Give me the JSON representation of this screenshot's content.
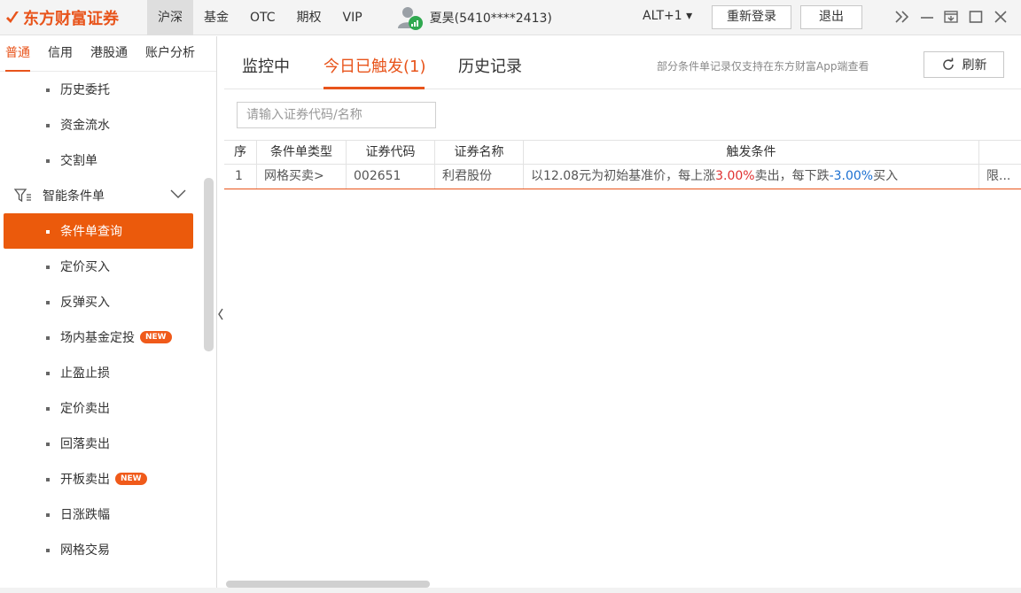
{
  "app": {
    "logo_text": "东方财富证券",
    "brand_color": "#e8541b"
  },
  "topbar": {
    "market_tabs": [
      {
        "label": "沪深",
        "active": true
      },
      {
        "label": "基金",
        "active": false
      },
      {
        "label": "OTC",
        "active": false
      },
      {
        "label": "期权",
        "active": false
      },
      {
        "label": "VIP",
        "active": false
      }
    ],
    "user_label": "夏昊(5410****2413)",
    "alt_label": "ALT+1 ▾",
    "relogin_label": "重新登录",
    "logout_label": "退出"
  },
  "sidebar": {
    "tabs": [
      {
        "label": "普通",
        "active": true
      },
      {
        "label": "信用",
        "active": false
      },
      {
        "label": "港股通",
        "active": false
      },
      {
        "label": "账户分析",
        "active": false
      }
    ],
    "items_top": [
      {
        "label": "历史委托"
      },
      {
        "label": "资金流水"
      },
      {
        "label": "交割单"
      }
    ],
    "group_label": "智能条件单",
    "items": [
      {
        "label": "条件单查询",
        "active": true,
        "badge": ""
      },
      {
        "label": "定价买入",
        "active": false,
        "badge": ""
      },
      {
        "label": "反弹买入",
        "active": false,
        "badge": ""
      },
      {
        "label": "场内基金定投",
        "active": false,
        "badge": "NEW"
      },
      {
        "label": "止盈止损",
        "active": false,
        "badge": ""
      },
      {
        "label": "定价卖出",
        "active": false,
        "badge": ""
      },
      {
        "label": "回落卖出",
        "active": false,
        "badge": ""
      },
      {
        "label": "开板卖出",
        "active": false,
        "badge": "NEW"
      },
      {
        "label": "日涨跌幅",
        "active": false,
        "badge": ""
      },
      {
        "label": "网格交易",
        "active": false,
        "badge": ""
      }
    ]
  },
  "main": {
    "tabs": [
      {
        "label": "监控中",
        "active": false
      },
      {
        "label": "今日已触发(1)",
        "active": true
      },
      {
        "label": "历史记录",
        "active": false
      }
    ],
    "note": "部分条件单记录仅支持在东方财富App端查看",
    "refresh_label": "刷新",
    "search_placeholder": "请输入证券代码/名称",
    "table": {
      "headers": [
        "序",
        "条件单类型",
        "证券代码",
        "证券名称",
        "触发条件"
      ],
      "rows": [
        {
          "seq": "1",
          "type": "网格买卖>",
          "code": "002651",
          "name": "利君股份",
          "cond_a": "以12.08元为初始基准价，每上涨",
          "cond_up": "3.00%",
          "cond_b": "卖出，每下跌",
          "cond_down": "-3.00%",
          "cond_c": "买入",
          "more": "限..."
        }
      ]
    }
  }
}
